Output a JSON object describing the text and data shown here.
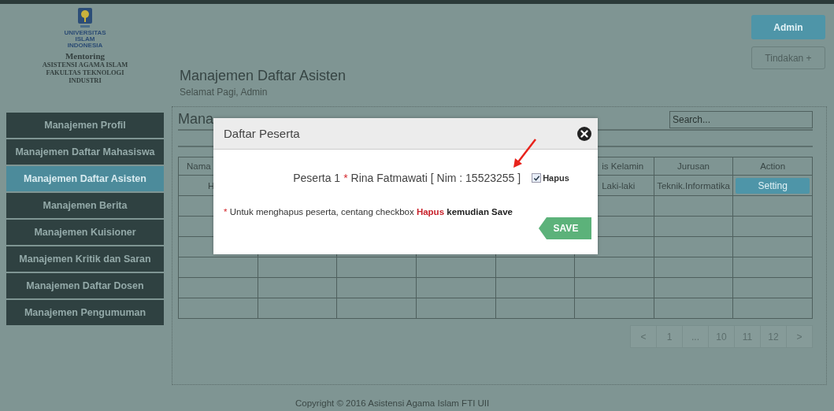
{
  "sidebar": {
    "logo_lines": [
      "UNIVERSITAS",
      "ISLAM",
      "INDONESIA"
    ],
    "app_title": "Mentoring",
    "app_subtitle": [
      "ASISTENSI AGAMA ISLAM",
      "FAKULTAS TEKNOLOGI",
      "INDUSTRI"
    ],
    "items": [
      {
        "label": "Manajemen Profil",
        "selected": false
      },
      {
        "label": "Manajemen Daftar Mahasiswa",
        "selected": false
      },
      {
        "label": "Manajemen Daftar Asisten",
        "selected": true
      },
      {
        "label": "Manajemen Berita",
        "selected": false
      },
      {
        "label": "Manajemen Kuisioner",
        "selected": false
      },
      {
        "label": "Manajemen Kritik dan Saran",
        "selected": false
      },
      {
        "label": "Manajemen Daftar Dosen",
        "selected": false
      },
      {
        "label": "Manajemen Pengumuman",
        "selected": false
      }
    ]
  },
  "header": {
    "user_button": "Admin",
    "actions_button": "Tindakan +",
    "title": "Manajemen Daftar Asisten",
    "greeting": "Selamat Pagi, Admin"
  },
  "panel": {
    "heading": "Mana",
    "search": {
      "placeholder": "Search..."
    },
    "table": {
      "columns": [
        {
          "label": "Nama"
        },
        {},
        {},
        {},
        {},
        {
          "label": "is Kelamin"
        },
        {
          "label": "Jurusan"
        },
        {
          "label": "Action"
        }
      ],
      "rows": [
        {
          "cells": [
            "H",
            null,
            null,
            null,
            null,
            "Laki-laki",
            "Teknik.Informatika",
            null
          ],
          "action": "Setting"
        },
        {
          "cells": [
            null,
            null,
            null,
            null,
            null,
            null,
            null,
            null
          ]
        },
        {
          "cells": [
            null,
            null,
            null,
            null,
            null,
            null,
            null,
            null
          ]
        },
        {
          "cells": [
            null,
            null,
            null,
            null,
            null,
            null,
            null,
            null
          ]
        },
        {
          "cells": [
            null,
            null,
            null,
            null,
            null,
            null,
            null,
            null
          ]
        },
        {
          "cells": [
            null,
            null,
            null,
            null,
            null,
            null,
            null,
            null
          ]
        },
        {
          "cells": [
            null,
            null,
            null,
            null,
            null,
            null,
            null,
            null
          ]
        }
      ]
    },
    "pagination": [
      "<",
      "1",
      "...",
      "10",
      "11",
      "12",
      ">"
    ]
  },
  "modal": {
    "title": "Daftar Peserta",
    "participant_label": "Peserta 1",
    "required_mark": "*",
    "participant_text": "Rina Fatmawati [ Nim : 15523255 ]",
    "delete_checkbox": {
      "label": "Hapus",
      "checked": true
    },
    "note_mark": "*",
    "note": "Untuk menghapus peserta, centang checkbox **Hapus** **kemudian Save**",
    "save_button": "SAVE"
  },
  "footer": "Copyright © 2016 Asistensi Agama Islam FTI UII"
}
